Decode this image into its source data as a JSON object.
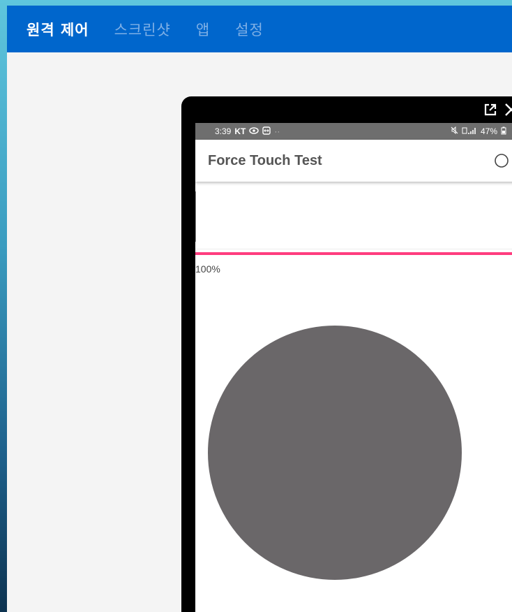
{
  "nav": {
    "tabs": [
      {
        "label": "원격 제어",
        "active": true
      },
      {
        "label": "스크린샷",
        "active": false
      },
      {
        "label": "앱",
        "active": false
      },
      {
        "label": "설정",
        "active": false
      }
    ]
  },
  "device_tools": {
    "icons": [
      "popout-icon",
      "close-icon"
    ]
  },
  "statusbar": {
    "time": "3:39",
    "carrier": "KT",
    "battery": "47%"
  },
  "app": {
    "title": "Force Touch Test",
    "pressure": "100%"
  },
  "colors": {
    "topbar": "#0066cc",
    "accent_line": "#ff3d7f",
    "circle": "#6a6769"
  }
}
